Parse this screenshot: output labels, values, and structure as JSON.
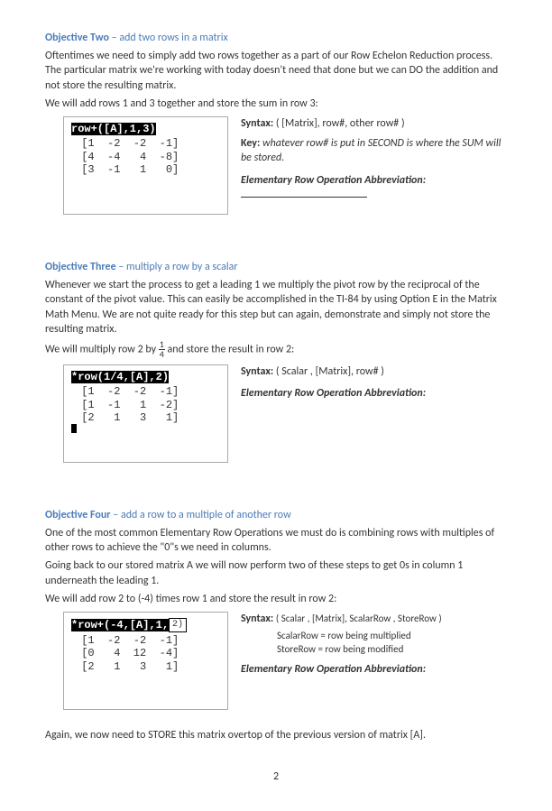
{
  "obj2": {
    "heading": "Objective Two",
    "subtitle": " – add two rows in a matrix",
    "p1": "Oftentimes we need to simply add two rows together as a part of our Row Echelon Reduction process. The particular matrix we're working with today doesn't need that done but we can DO the addition and not store the resulting matrix.",
    "p2": "We will add rows 1 and 3 together and store the sum in row 3:",
    "cmd": "row+([A],1,3)",
    "matrix": " [1  -2  -2  -1]\n [4  -4   4  -8]\n [3  -1   1   0]",
    "syntax_lbl": "Syntax:",
    "syntax_val": "( [Matrix], row#, other row# )",
    "key_lbl": "Key:",
    "key_val": "whatever row# is put in SECOND is where the SUM will be stored.",
    "abbrev": "Elementary Row Operation Abbreviation:"
  },
  "obj3": {
    "heading": "Objective Three",
    "subtitle": " – multiply a row by a scalar",
    "p1": "Whenever we start the process to get a leading 1 we multiply the pivot row by the reciprocal of the constant of the pivot value. This can easily be accomplished in the TI-84 by using Option E in the Matrix Math Menu.  We are not quite ready for this step but can again, demonstrate and simply not store the resulting matrix.",
    "p2a": "We will multiply row 2 by ",
    "frac_top": "1",
    "frac_bot": "4",
    "p2b": " and store the result in row 2:",
    "cmd": "*row(1/4,[A],2)",
    "matrix": " [1  -2  -2  -1]\n [1  -1   1  -2]\n [2   1   3   1]",
    "syntax_lbl": "Syntax:",
    "syntax_val": "( Scalar , [Matrix], row# )",
    "abbrev": "Elementary Row Operation Abbreviation:"
  },
  "obj4": {
    "heading": "Objective Four",
    "subtitle": " – add a row to a multiple of another row",
    "p1": "One of the most common Elementary Row Operations we must do is combining rows with multiples of other rows to achieve the \"0\"s we need in columns.",
    "p2": "Going back to our stored matrix A we will now perform two of these steps to get 0s in column 1 underneath the leading 1.",
    "p3": "We will add row 2 to (-4) times row 1 and store the result in row 2:",
    "cmd": "*row+(-4,[A],1,",
    "cmd_suffix": "2)",
    "matrix": " [1  -2  -2  -1]\n [0   4  12  -4]\n [2   1   3   1]",
    "syntax_lbl": "Syntax:",
    "syntax_val": "( Scalar , [Matrix], ScalarRow , StoreRow )",
    "note1": "ScalarRow = row being multiplied",
    "note2": "StoreRow = row being modified",
    "abbrev": "Elementary Row Operation Abbreviation:",
    "p4a": "Again, we now need to ",
    "p4b": "STORE",
    "p4c": " this matrix overtop of the previous version of matrix [",
    "p4d": "A",
    "p4e": "]."
  },
  "page_num": "2"
}
